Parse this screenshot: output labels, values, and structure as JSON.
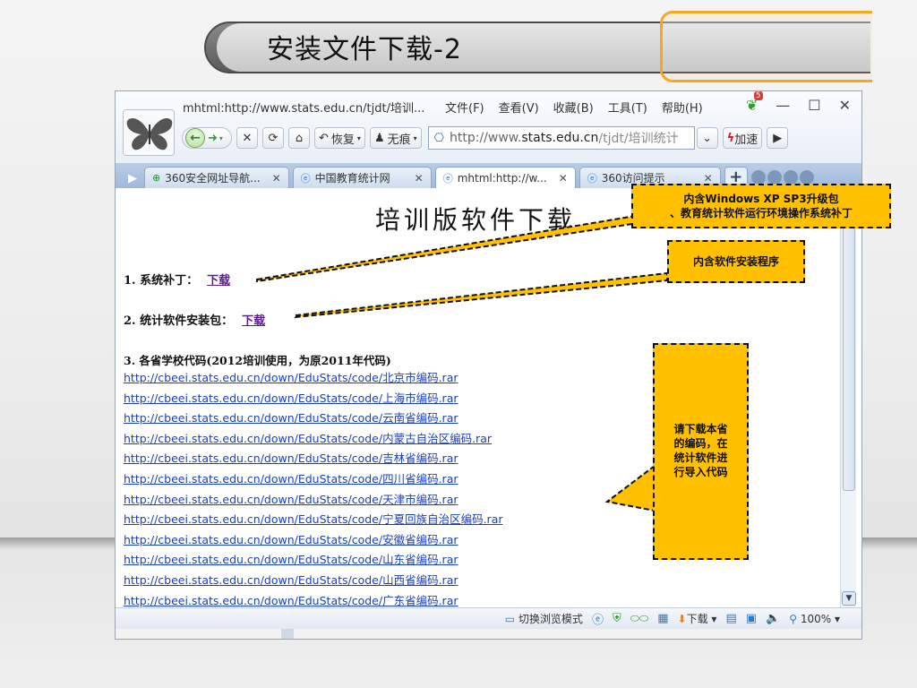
{
  "slide": {
    "title": "安装文件下载-2"
  },
  "browser": {
    "window_title": "mhtml:http://www.stats.edu.cn/tjdt/培训...",
    "menu": [
      "文件(F)",
      "查看(V)",
      "收藏(B)",
      "工具(T)",
      "帮助(H)"
    ],
    "notification_count": "5",
    "nav": {
      "restore_label": "恢复",
      "incognito_label": "无痕",
      "speed_label": "加速"
    },
    "address": {
      "scheme": "http://www.",
      "host": "stats.edu.cn",
      "path": "/tjdt/培训统计"
    },
    "tabs": [
      {
        "label": "360安全网址导航...",
        "icon": "globe-icon",
        "active": false
      },
      {
        "label": "中国教育统计网",
        "icon": "ie-page-icon",
        "active": false
      },
      {
        "label": "mhtml:http://w...",
        "icon": "ie-page-icon",
        "active": true
      },
      {
        "label": "360访问提示",
        "icon": "ie-page-icon",
        "active": false
      }
    ],
    "status": {
      "mode_label": "切换浏览模式",
      "download_label": "下载",
      "zoom": "100%"
    }
  },
  "page": {
    "heading": "培训版软件下载",
    "item1_label": "1. 系统补丁：",
    "item1_link": "下载",
    "item2_label": "2. 统计软件安装包：",
    "item2_link": "下载",
    "item3_label": "3. 各省学校代码(2012培训使用，为原2011年代码)",
    "code_links": [
      "http://cbeei.stats.edu.cn/down/EduStats/code/北京市编码.rar",
      "http://cbeei.stats.edu.cn/down/EduStats/code/上海市编码.rar",
      "http://cbeei.stats.edu.cn/down/EduStats/code/云南省编码.rar",
      "http://cbeei.stats.edu.cn/down/EduStats/code/内蒙古自治区编码.rar",
      "http://cbeei.stats.edu.cn/down/EduStats/code/吉林省编码.rar",
      "http://cbeei.stats.edu.cn/down/EduStats/code/四川省编码.rar",
      "http://cbeei.stats.edu.cn/down/EduStats/code/天津市编码.rar",
      "http://cbeei.stats.edu.cn/down/EduStats/code/宁夏回族自治区编码.rar",
      "http://cbeei.stats.edu.cn/down/EduStats/code/安徽省编码.rar",
      "http://cbeei.stats.edu.cn/down/EduStats/code/山东省编码.rar",
      "http://cbeei.stats.edu.cn/down/EduStats/code/山西省编码.rar",
      "http://cbeei.stats.edu.cn/down/EduStats/code/广东省编码.rar"
    ]
  },
  "callouts": {
    "patch_line1": "内含Windows XP SP3升级包",
    "patch_line2": "、教育统计软件运行环境操作系统补丁",
    "installer": "内含软件安装程序",
    "codes_line1": "请下载本省",
    "codes_line2": "的编码，在",
    "codes_line3": "统计软件进",
    "codes_line4": "行导入代码"
  },
  "colors": {
    "callout_fill": "#ffc000",
    "link_blue": "#1a3fbf",
    "link_visited": "#5b1c8c"
  }
}
